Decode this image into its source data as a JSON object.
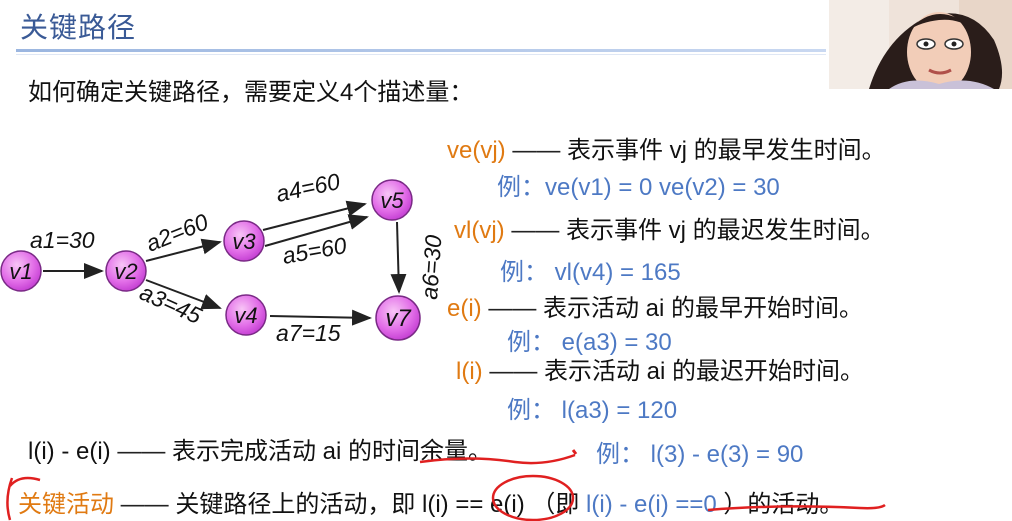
{
  "slide": {
    "title": "关键路径",
    "intro": "如何确定关键路径，需要定义4个描述量："
  },
  "graph": {
    "nodes": [
      "v1",
      "v2",
      "v3",
      "v4",
      "v5",
      "v7"
    ],
    "edges": [
      "a1=30",
      "a2=60",
      "a3=45",
      "a4=60",
      "a5=60",
      "a6=30",
      "a7=15"
    ],
    "node_color": "#e26ee8",
    "node_stroke": "#7a2a86"
  },
  "definitions": [
    {
      "term": "ve(vj)",
      "dash": "——",
      "desc": "表示事件 vj 的最早发生时间。",
      "example": "例：ve(v1) = 0      ve(v2) = 30"
    },
    {
      "term": "vl(vj)",
      "dash": "——",
      "desc": "表示事件 vj 的最迟发生时间。",
      "example": "例：  vl(v4) = 165"
    },
    {
      "term": "e(i)",
      "dash": "——",
      "desc": "表示活动 ai 的最早开始时间。",
      "example": "例：  e(a3) = 30"
    },
    {
      "term": "l(i)",
      "dash": "——",
      "desc": "表示活动 ai 的最迟开始时间。",
      "example": "例：  l(a3) = 120"
    }
  ],
  "slack": {
    "term": "l(i) - e(i)",
    "dash": "——",
    "desc": "表示完成活动 ai 的时间余量。",
    "example": "例：  l(3) - e(3) = 90"
  },
  "critical": {
    "term": "关键活动",
    "dash": "——",
    "desc": "关键路径上的活动，即",
    "cond": "l(i) == e(i)",
    "paren_open": "（即",
    "cond2": "l(i) - e(i) ==0",
    "paren_close": "）的活动。"
  },
  "colors": {
    "title": "#3a5a96",
    "term": "#e07a12",
    "example": "#4d79c4",
    "annotation": "#e02020"
  }
}
